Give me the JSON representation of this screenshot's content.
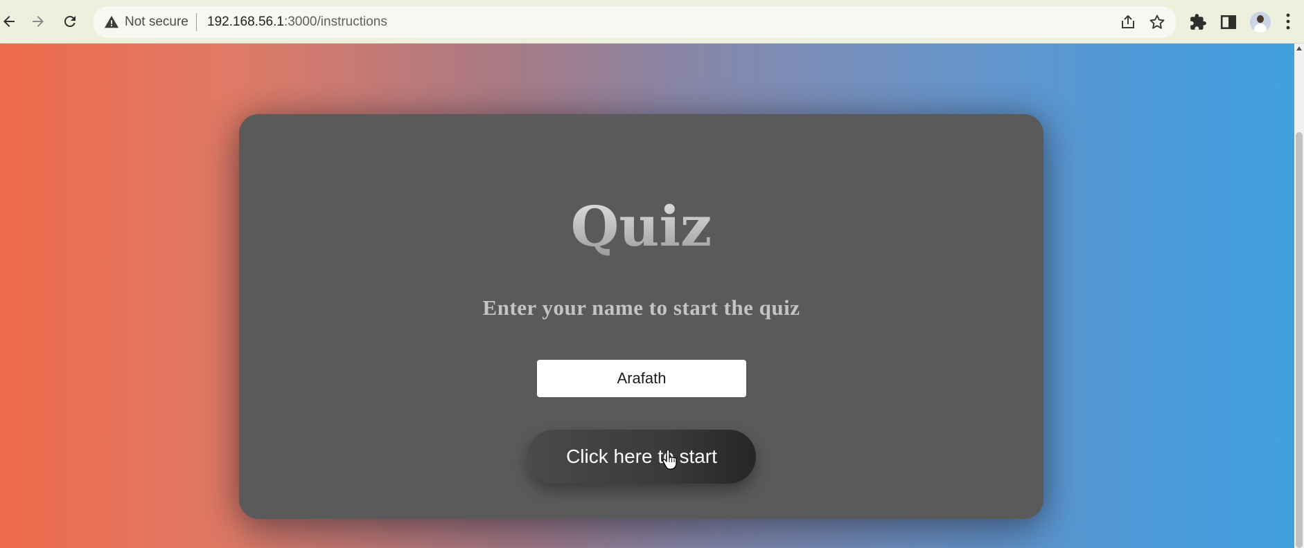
{
  "browser": {
    "security_label": "Not secure",
    "url_host": "192.168.56.1",
    "url_path": ":3000/instructions"
  },
  "page": {
    "title": "Quiz",
    "subtitle": "Enter your name to start the quiz",
    "name_input_value": "Arafath",
    "start_button_label": "Click here to start"
  },
  "colors": {
    "card_background": "#5a5a5a",
    "gradient_left": "#ee6a4c",
    "gradient_right": "#42a0df"
  }
}
